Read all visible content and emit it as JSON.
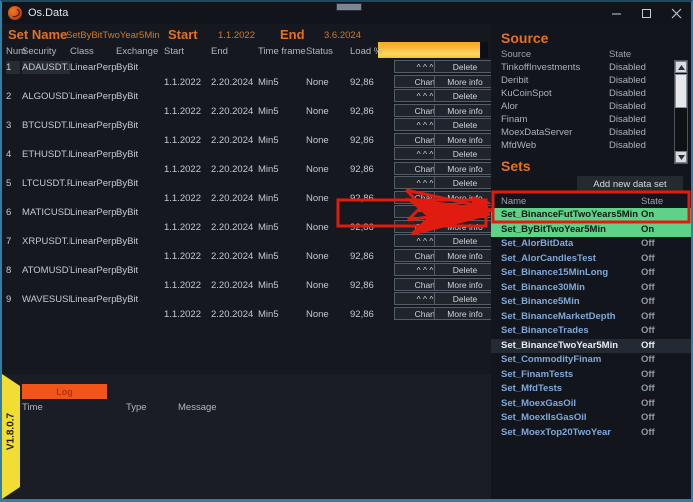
{
  "window": {
    "title": "Os.Data",
    "icon": "app-logo-icon",
    "minimize": "minimize-icon",
    "maximize": "maximize-icon",
    "close": "close-icon"
  },
  "header": {
    "set_name_label": "Set Name",
    "set_name_value": "SetByBitTwoYear5Min",
    "start_label": "Start",
    "start_value": "1.1.2022",
    "end_label": "End",
    "end_value": "3.6.2024",
    "progress_percent": 93
  },
  "grid": {
    "columns": [
      "Num",
      "Security",
      "Class",
      "Exchange",
      "Start",
      "End",
      "Time frame",
      "Status",
      "Load %"
    ],
    "row_buttons": {
      "expand": "^ ^ ^",
      "delete": "Delete",
      "chart": "Chart",
      "more_info": "More info"
    },
    "rows": [
      {
        "num": "1",
        "security": "ADAUSDT.P",
        "class": "LinearPerpetu",
        "exchange": "ByBit",
        "start": "1.1.2022",
        "end": "2.20.2024",
        "timeframe": "Min5",
        "status": "None",
        "load": "92,86",
        "selected": true
      },
      {
        "num": "2",
        "security": "ALGOUSDT.P",
        "class": "LinearPerpetu",
        "exchange": "ByBit",
        "start": "1.1.2022",
        "end": "2.20.2024",
        "timeframe": "Min5",
        "status": "None",
        "load": "92,86",
        "selected": false
      },
      {
        "num": "3",
        "security": "BTCUSDT.P",
        "class": "LinearPerpetu",
        "exchange": "ByBit",
        "start": "1.1.2022",
        "end": "2.20.2024",
        "timeframe": "Min5",
        "status": "None",
        "load": "92,86",
        "selected": false
      },
      {
        "num": "4",
        "security": "ETHUSDT.P",
        "class": "LinearPerpetu",
        "exchange": "ByBit",
        "start": "1.1.2022",
        "end": "2.20.2024",
        "timeframe": "Min5",
        "status": "None",
        "load": "92,86",
        "selected": false
      },
      {
        "num": "5",
        "security": "LTCUSDT.P",
        "class": "LinearPerpetu",
        "exchange": "ByBit",
        "start": "1.1.2022",
        "end": "2.20.2024",
        "timeframe": "Min5",
        "status": "None",
        "load": "92,86",
        "selected": false
      },
      {
        "num": "6",
        "security": "MATICUSDT.f",
        "class": "LinearPerpetu",
        "exchange": "ByBit",
        "start": "1.1.2022",
        "end": "2.20.2024",
        "timeframe": "Min5",
        "status": "None",
        "load": "92,86",
        "selected": false
      },
      {
        "num": "7",
        "security": "XRPUSDT.P",
        "class": "LinearPerpetu",
        "exchange": "ByBit",
        "start": "1.1.2022",
        "end": "2.20.2024",
        "timeframe": "Min5",
        "status": "None",
        "load": "92,86",
        "selected": false
      },
      {
        "num": "8",
        "security": "ATOMUSDT.P",
        "class": "LinearPerpetu",
        "exchange": "ByBit",
        "start": "1.1.2022",
        "end": "2.20.2024",
        "timeframe": "Min5",
        "status": "None",
        "load": "92,86",
        "selected": false
      },
      {
        "num": "9",
        "security": "WAVESUSDT.",
        "class": "LinearPerpetu",
        "exchange": "ByBit",
        "start": "1.1.2022",
        "end": "2.20.2024",
        "timeframe": "Min5",
        "status": "None",
        "load": "92,86",
        "selected": false
      }
    ]
  },
  "source_panel": {
    "title": "Source",
    "columns": [
      "Source",
      "State"
    ],
    "rows": [
      {
        "name": "TinkoffInvestments",
        "state": "Disabled"
      },
      {
        "name": "Deribit",
        "state": "Disabled"
      },
      {
        "name": "KuCoinSpot",
        "state": "Disabled"
      },
      {
        "name": "Alor",
        "state": "Disabled"
      },
      {
        "name": "Finam",
        "state": "Disabled"
      },
      {
        "name": "MoexDataServer",
        "state": "Disabled"
      },
      {
        "name": "MfdWeb",
        "state": "Disabled"
      }
    ],
    "scrollbar": {
      "up": "scroll-up-icon",
      "down": "scroll-down-icon"
    }
  },
  "sets_panel": {
    "title": "Sets",
    "add_button": "Add new data set",
    "columns": [
      "Name",
      "State"
    ],
    "rows": [
      {
        "name": "Set_BinanceFutTwoYears5Min",
        "state": "On",
        "highlight": "on"
      },
      {
        "name": "Set_ByBitTwoYear5Min",
        "state": "On",
        "highlight": "on"
      },
      {
        "name": "Set_AlorBitData",
        "state": "Off",
        "highlight": ""
      },
      {
        "name": "Set_AlorCandlesTest",
        "state": "Off",
        "highlight": ""
      },
      {
        "name": "Set_Binance15MinLong",
        "state": "Off",
        "highlight": ""
      },
      {
        "name": "Set_Binance30Min",
        "state": "Off",
        "highlight": ""
      },
      {
        "name": "Set_Binance5Min",
        "state": "Off",
        "highlight": ""
      },
      {
        "name": "Set_BinanceMarketDepth",
        "state": "Off",
        "highlight": ""
      },
      {
        "name": "Set_BinanceTrades",
        "state": "Off",
        "highlight": ""
      },
      {
        "name": "Set_BinanceTwoYear5Min",
        "state": "Off",
        "highlight": "cur"
      },
      {
        "name": "Set_CommodityFinam",
        "state": "Off",
        "highlight": ""
      },
      {
        "name": "Set_FinamTests",
        "state": "Off",
        "highlight": ""
      },
      {
        "name": "Set_MfdTests",
        "state": "Off",
        "highlight": ""
      },
      {
        "name": "Set_MoexGasOil",
        "state": "Off",
        "highlight": ""
      },
      {
        "name": "Set_MoexIIsGasOil",
        "state": "Off",
        "highlight": ""
      },
      {
        "name": "Set_MoexTop20TwoYear",
        "state": "Off",
        "highlight": ""
      }
    ]
  },
  "log_panel": {
    "tab_label": "Log",
    "columns": [
      "Time",
      "Type",
      "Message"
    ]
  },
  "version_bar": {
    "version": "V1.8.0.7"
  },
  "annotations": {
    "color": "#e01b10",
    "note": "red rectangle over rows 6-7 action buttons with arrows to highlighted set rows"
  }
}
